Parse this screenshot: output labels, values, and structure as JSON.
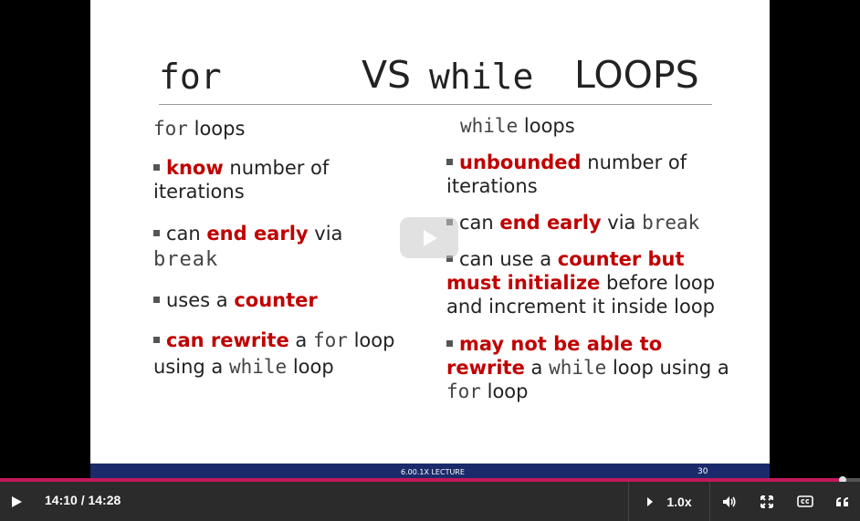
{
  "slide": {
    "title": {
      "for": "for",
      "vs": "VS",
      "while": "while",
      "loops": "LOOPS"
    },
    "left": {
      "header_mono": "for",
      "header_text": " loops",
      "b1_red": "know",
      "b1_rest": " number of iterations",
      "b2_pre": "can ",
      "b2_red": "end early",
      "b2_post": " via",
      "b2_mono": "break",
      "b3_pre": "uses a ",
      "b3_red": "counter",
      "b4_red": "can rewrite",
      "b4_a": " a ",
      "b4_mono1": "for",
      "b4_b": "  loop using a ",
      "b4_mono2": "while",
      "b4_c": "  loop"
    },
    "right": {
      "header_mono": "while",
      "header_text": " loops",
      "b1_red": "unbounded",
      "b1_rest": " number of iterations",
      "b2_pre": "can ",
      "b2_red": "end early",
      "b2_post": " via ",
      "b2_mono": "break",
      "b3_pre": "can use a ",
      "b3_red": "counter but must initialize",
      "b3_post": " before loop and increment it inside loop",
      "b4_red": "may not be able to rewrite",
      "b4_a": " a ",
      "b4_mono1": "while",
      "b4_b": " loop using a ",
      "b4_mono2": "for",
      "b4_c": " loop"
    },
    "footer": {
      "lecture": "6.00.1X LECTURE",
      "page": "30"
    }
  },
  "player": {
    "time": "14:10 / 14:28",
    "progress": 0.98,
    "speed": "1.0x",
    "icons": [
      "play-icon",
      "volume-icon",
      "fullscreen-icon",
      "closed-captions-icon",
      "transcript-icon"
    ],
    "accent_color": "#c2185b"
  }
}
